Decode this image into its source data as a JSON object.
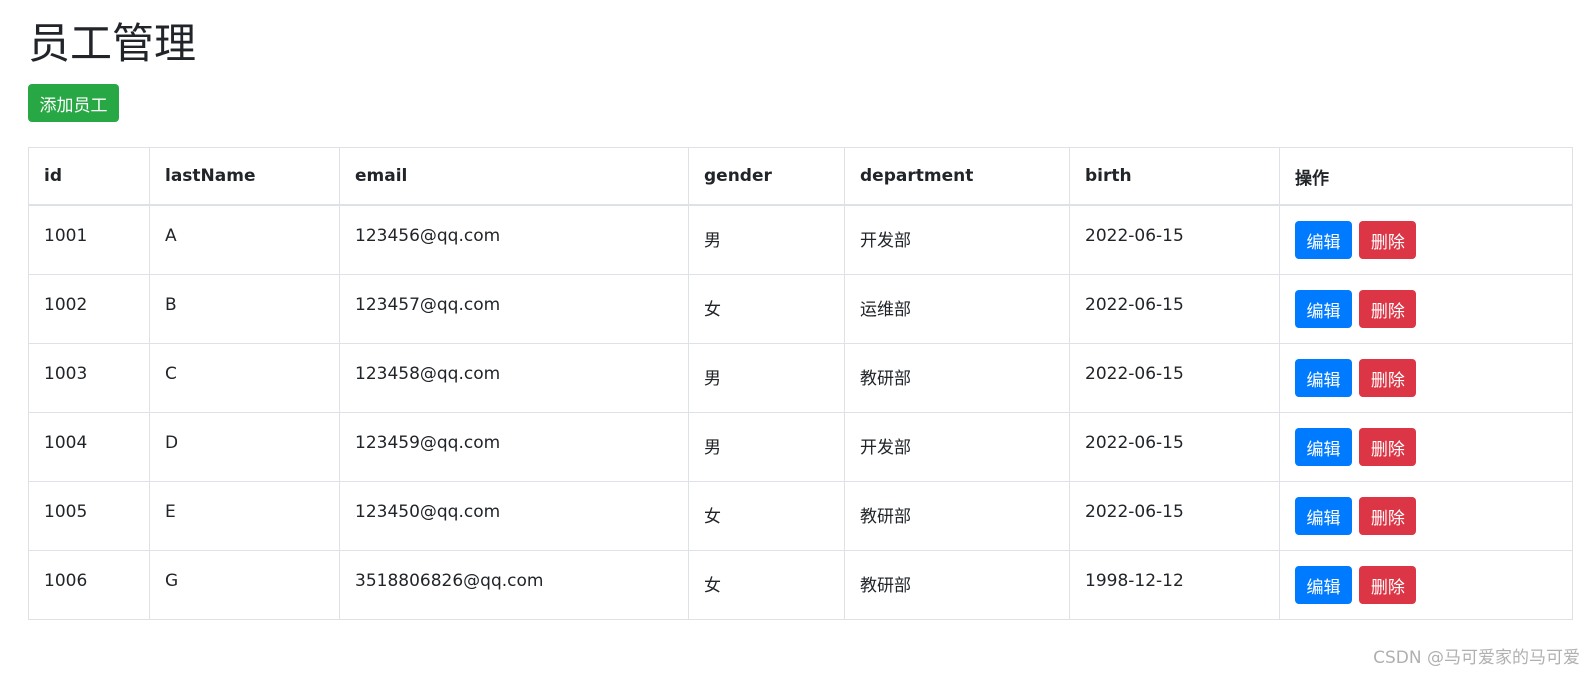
{
  "page": {
    "title": "员工管理",
    "add_button_label": "添加员工"
  },
  "table": {
    "headers": [
      "id",
      "lastName",
      "email",
      "gender",
      "department",
      "birth",
      "操作"
    ],
    "rows": [
      {
        "id": "1001",
        "lastName": "A",
        "email": "123456@qq.com",
        "gender": "男",
        "department": "开发部",
        "birth": "2022-06-15"
      },
      {
        "id": "1002",
        "lastName": "B",
        "email": "123457@qq.com",
        "gender": "女",
        "department": "运维部",
        "birth": "2022-06-15"
      },
      {
        "id": "1003",
        "lastName": "C",
        "email": "123458@qq.com",
        "gender": "男",
        "department": "教研部",
        "birth": "2022-06-15"
      },
      {
        "id": "1004",
        "lastName": "D",
        "email": "123459@qq.com",
        "gender": "男",
        "department": "开发部",
        "birth": "2022-06-15"
      },
      {
        "id": "1005",
        "lastName": "E",
        "email": "123450@qq.com",
        "gender": "女",
        "department": "教研部",
        "birth": "2022-06-15"
      },
      {
        "id": "1006",
        "lastName": "G",
        "email": "3518806826@qq.com",
        "gender": "女",
        "department": "教研部",
        "birth": "1998-12-12"
      }
    ],
    "edit_label": "编辑",
    "delete_label": "删除"
  },
  "watermark": "CSDN @马可爱家的马可爱",
  "colors": {
    "add_button": "#28a745",
    "edit_button": "#007bff",
    "delete_button": "#dc3545",
    "border": "#dee2e6"
  }
}
